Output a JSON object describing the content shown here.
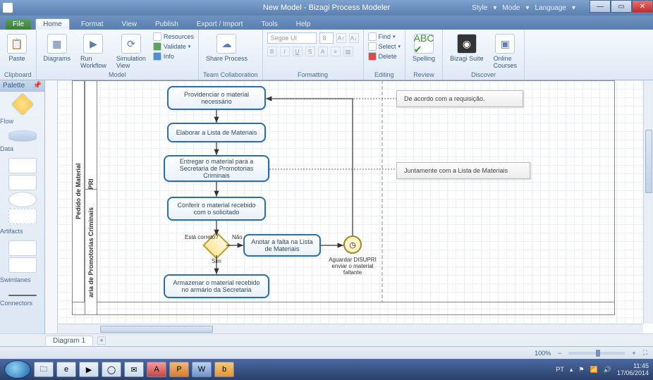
{
  "window": {
    "title": "New Model - Bizagi Process Modeler",
    "meta_style": "Style",
    "meta_mode": "Mode",
    "meta_language": "Language"
  },
  "tabs": {
    "file": "File",
    "items": [
      "Home",
      "Format",
      "View",
      "Publish",
      "Export / Import",
      "Tools",
      "Help"
    ],
    "active": "Home"
  },
  "ribbon": {
    "clipboard": {
      "label": "Clipboard",
      "paste": "Paste"
    },
    "model": {
      "label": "Model",
      "diagrams": "Diagrams",
      "run": "Run\nWorkflow",
      "sim": "Simulation\nView",
      "resources": "Resources",
      "validate": "Validate",
      "info": "Info"
    },
    "team": {
      "label": "Team Collaboration",
      "share": "Share Process"
    },
    "formatting": {
      "label": "Formatting",
      "font": "Segoe UI",
      "size": "8"
    },
    "editing": {
      "label": "Editing",
      "find": "Find",
      "select": "Select",
      "delete": "Delete"
    },
    "review": {
      "label": "Review",
      "spelling": "Spelling"
    },
    "discover": {
      "label": "Discover",
      "suite": "Bizagi Suite",
      "courses": "Online\nCourses"
    }
  },
  "palette": {
    "title": "Palette",
    "sections": [
      "Flow",
      "Data",
      "Artifacts",
      "Swimlanes",
      "Connectors"
    ]
  },
  "diagram": {
    "pool": "Pedido de Material",
    "lane1": "DISUPRI",
    "lane2": "aria de Promotorias Criminais",
    "task1": "Providenciar o material necessário",
    "task2": "Elaborar a Lista de Materiais",
    "task3": "Entregar o material para a Secretaria de Promotorias Criminais",
    "task4": "Conferir o material recebido com o solicitado",
    "task5": "Anotar a falta na Lista de Materiais",
    "task6": "Armazenar o material recebido no armário da Secretaria",
    "gw_label": "Está correto?",
    "gw_yes": "Sim",
    "gw_no": "Não",
    "timer": "Aguardar DISUPRI enviar o material faltante",
    "ann1": "De acordo com a requisição.",
    "ann2": "Juntamente com a Lista de Materiais"
  },
  "diagtabs": {
    "name": "Diagram 1"
  },
  "status": {
    "zoom": "100%"
  },
  "tray": {
    "lang": "PT",
    "time": "11:45",
    "date": "17/06/2014"
  }
}
